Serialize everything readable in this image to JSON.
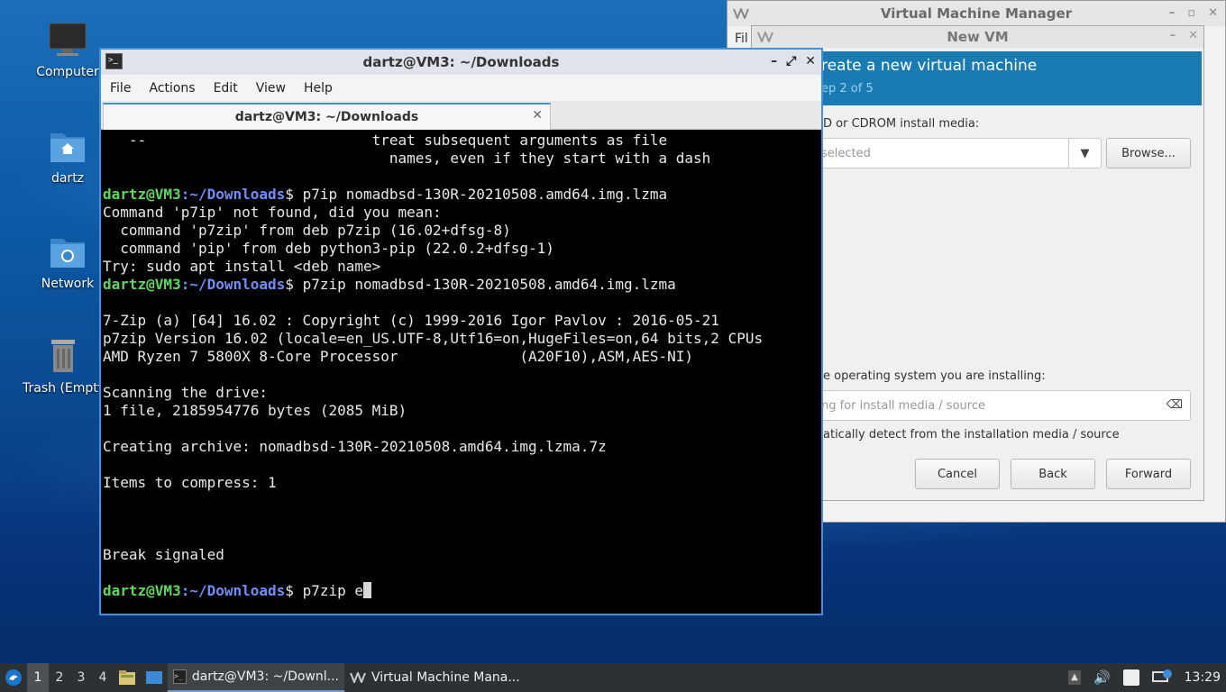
{
  "desktop": {
    "icons": [
      {
        "label": "Computer"
      },
      {
        "label": "dartz"
      },
      {
        "label": "Network"
      },
      {
        "label": "Trash (Empty)"
      }
    ]
  },
  "vmm": {
    "title": "Virtual Machine Manager",
    "menu_file": "Fil"
  },
  "newvm": {
    "title": "New VM",
    "header_title": "reate a new virtual machine",
    "header_step": "ep 2 of 5",
    "media_label": "D or CDROM install media:",
    "media_placeholder": " selected",
    "browse_label": "Browse...",
    "os_label": "e operating system you are installing:",
    "os_placeholder": "ng for install media / source",
    "auto_detect_label": "atically detect from the installation media / source",
    "cancel_label": "Cancel",
    "back_label": "Back",
    "forward_label": "Forward"
  },
  "terminal": {
    "title": "dartz@VM3: ~/Downloads",
    "menu": [
      "File",
      "Actions",
      "Edit",
      "View",
      "Help"
    ],
    "tab_label": "dartz@VM3: ~/Downloads",
    "prompt_user": "dartz@VM3",
    "prompt_path": ":~/Downloads",
    "lines": [
      {
        "t": "   --                          treat subsequent arguments as file"
      },
      {
        "t": "                                 names, even if they start with a dash"
      },
      {
        "t": ""
      },
      {
        "cmd": "p7ip nomadbsd-130R-20210508.amd64.img.lzma"
      },
      {
        "t": "Command 'p7ip' not found, did you mean:"
      },
      {
        "t": "  command 'p7zip' from deb p7zip (16.02+dfsg-8)"
      },
      {
        "t": "  command 'pip' from deb python3-pip (22.0.2+dfsg-1)"
      },
      {
        "t": "Try: sudo apt install <deb name>"
      },
      {
        "cmd": "p7zip nomadbsd-130R-20210508.amd64.img.lzma"
      },
      {
        "t": ""
      },
      {
        "t": "7-Zip (a) [64] 16.02 : Copyright (c) 1999-2016 Igor Pavlov : 2016-05-21"
      },
      {
        "t": "p7zip Version 16.02 (locale=en_US.UTF-8,Utf16=on,HugeFiles=on,64 bits,2 CPUs"
      },
      {
        "t": "AMD Ryzen 7 5800X 8-Core Processor              (A20F10),ASM,AES-NI)"
      },
      {
        "t": ""
      },
      {
        "t": "Scanning the drive:"
      },
      {
        "t": "1 file, 2185954776 bytes (2085 MiB)"
      },
      {
        "t": ""
      },
      {
        "t": "Creating archive: nomadbsd-130R-20210508.amd64.img.lzma.7z"
      },
      {
        "t": ""
      },
      {
        "t": "Items to compress: 1"
      },
      {
        "t": ""
      },
      {
        "t": ""
      },
      {
        "t": ""
      },
      {
        "t": "Break signaled"
      },
      {
        "t": ""
      },
      {
        "cmd": "p7zip e",
        "cursor": true
      }
    ]
  },
  "taskbar": {
    "workspaces": [
      "1",
      "2",
      "3",
      "4"
    ],
    "tasks": [
      {
        "label": "dartz@VM3: ~/Downl...",
        "icon": "terminal-icon"
      },
      {
        "label": "Virtual Machine Mana...",
        "icon": "vmm-icon"
      }
    ],
    "clock": "13:29"
  }
}
